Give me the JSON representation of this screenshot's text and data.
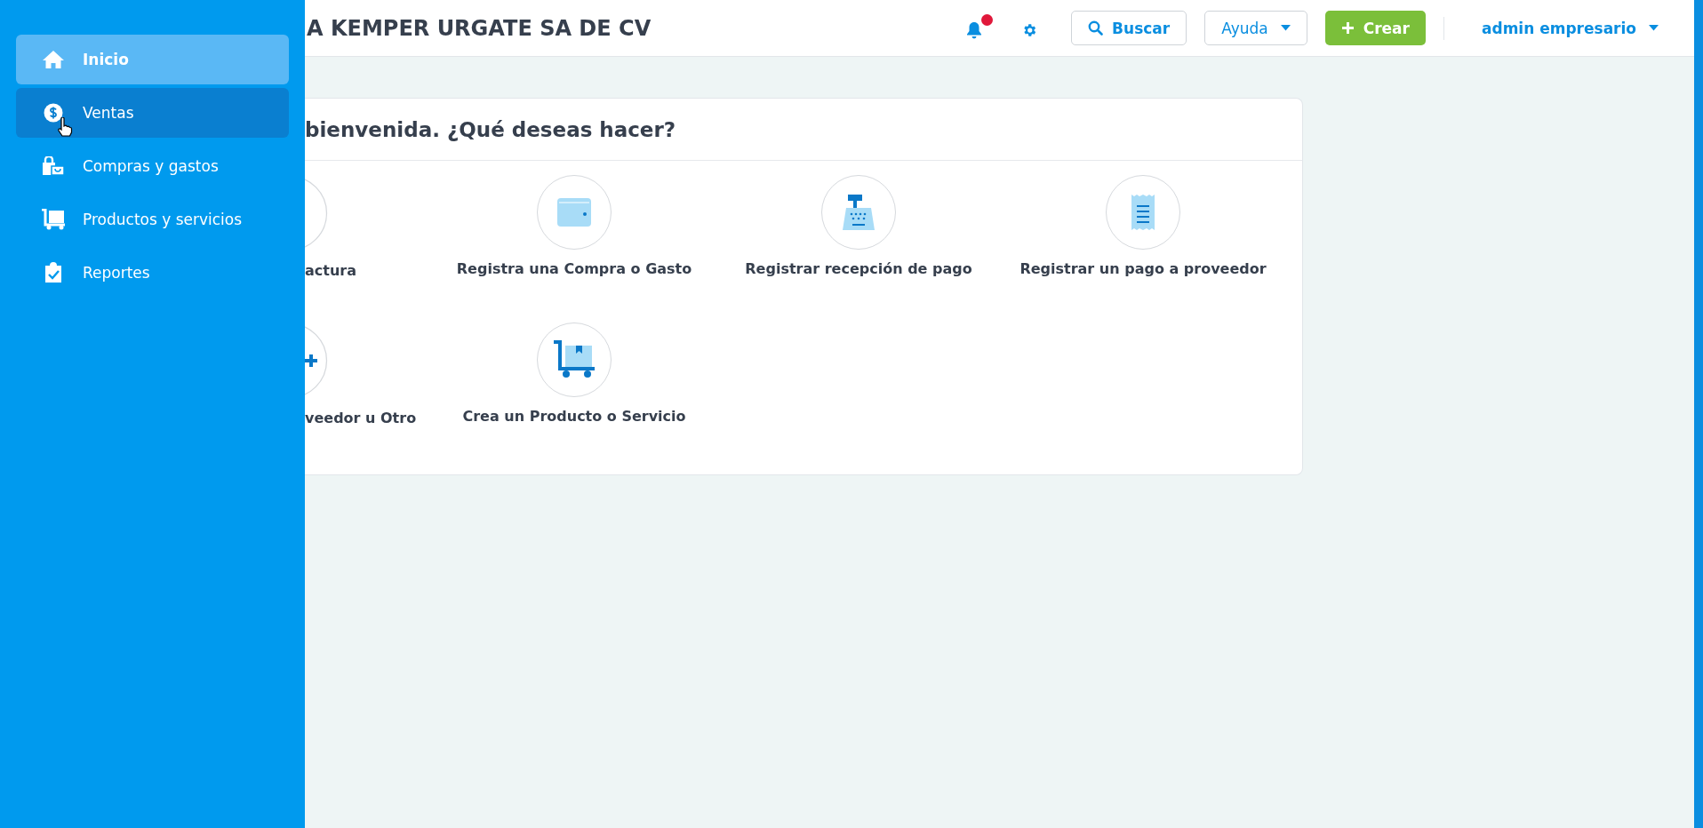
{
  "sidebar": {
    "items": [
      {
        "label": "Inicio",
        "selected": true,
        "hovered": false
      },
      {
        "label": "Ventas",
        "selected": false,
        "hovered": true
      },
      {
        "label": "Compras y gastos",
        "selected": false,
        "hovered": false
      },
      {
        "label": "Productos y servicios",
        "selected": false,
        "hovered": false
      },
      {
        "label": "Reportes",
        "selected": false,
        "hovered": false
      }
    ]
  },
  "header": {
    "title": "A KEMPER URGATE SA DE CV",
    "notifications": {
      "unread": true
    },
    "search_button": "Buscar",
    "help_button": "Ayuda",
    "create_button": "Crear",
    "user_menu": "admin empresario"
  },
  "card": {
    "title": "bienvenida. ¿Qué deseas hacer?",
    "actions": [
      {
        "label": "actura"
      },
      {
        "label": "Registra una Compra o Gasto"
      },
      {
        "label": "Registrar recepción de pago"
      },
      {
        "label": "Registrar un pago a proveedor"
      },
      {
        "label": "veedor u Otro"
      },
      {
        "label": "Crea un Producto o Servicio"
      }
    ]
  }
}
